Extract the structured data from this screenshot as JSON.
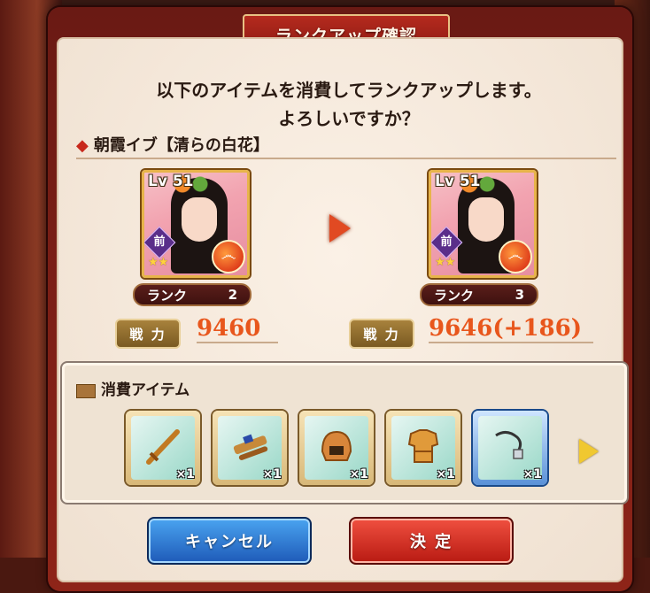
{
  "dialog": {
    "title": "ランクアップ確認",
    "message_line1": "以下のアイテムを消費してランクアップします。",
    "message_line2": "よろしいですか？",
    "character_name": "朝霞イブ【清らの白花】"
  },
  "before": {
    "level": "Lv 51",
    "position_badge": "前",
    "stars": "★★",
    "rank_label": "ランク",
    "rank_value": "2",
    "power_label": "戦 力",
    "power_value": "9460"
  },
  "after": {
    "level": "Lv 51",
    "position_badge": "前",
    "stars": "★★",
    "rank_label": "ランク",
    "rank_value": "3",
    "power_label": "戦 力",
    "power_value": "9646(+186)"
  },
  "items": {
    "title": "消費アイテム",
    "list": [
      {
        "icon": "sword-icon",
        "qty": "×1"
      },
      {
        "icon": "scroll-sheath-icon",
        "qty": "×1"
      },
      {
        "icon": "helmet-icon",
        "qty": "×1"
      },
      {
        "icon": "armor-icon",
        "qty": "×1"
      },
      {
        "icon": "amulet-icon",
        "qty": "×1"
      }
    ]
  },
  "buttons": {
    "cancel": "キャンセル",
    "ok": "決 定"
  },
  "colors": {
    "frame": "#8e2418",
    "power_value": "#e8561c",
    "cancel_button": "#1e5ab8",
    "ok_button": "#b81a12"
  }
}
